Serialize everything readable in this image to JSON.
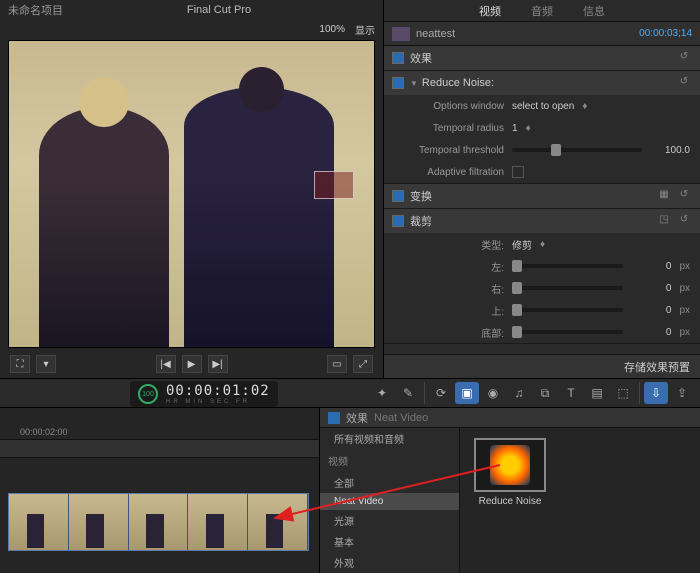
{
  "viewer": {
    "project": "未命名项目",
    "app": "Final Cut Pro",
    "zoom": "100%",
    "display": "显示"
  },
  "transport": {
    "prev": "|◀",
    "play": "▶",
    "next": "▶|"
  },
  "inspector": {
    "tabs": {
      "video": "视频",
      "audio": "音频",
      "info": "信息"
    },
    "clip": "neattest",
    "timecode": "00:00:03;14",
    "effects": "效果",
    "reduce_noise": {
      "title": "Reduce Noise:",
      "options_label": "Options window",
      "options_value": "select to open",
      "temporal_radius_label": "Temporal radius",
      "temporal_radius_value": "1",
      "temporal_threshold_label": "Temporal threshold",
      "temporal_threshold_value": "100.0",
      "adaptive_label": "Adaptive filtration"
    },
    "transform": "变换",
    "crop": {
      "title": "裁剪",
      "type_label": "类型:",
      "type_value": "修剪",
      "left": "左:",
      "right": "右:",
      "top": "上:",
      "bottom": "底部:",
      "val": "0",
      "unit": "px"
    },
    "save_preset": "存储效果预置"
  },
  "timecode": {
    "ring": "100",
    "digits": "00:00:01:02",
    "units": "HR  MIN  SEC  FR"
  },
  "timeline": {
    "t0": "00:00:02:00"
  },
  "browser": {
    "title": "效果",
    "crumb": "Neat Video",
    "all": "所有视频和音频",
    "cat_video": "视频",
    "items": {
      "all": "全部",
      "neat": "Neat Video",
      "light": "光源",
      "basic": "基本",
      "look": "外观"
    },
    "fx_name": "Reduce Noise"
  }
}
